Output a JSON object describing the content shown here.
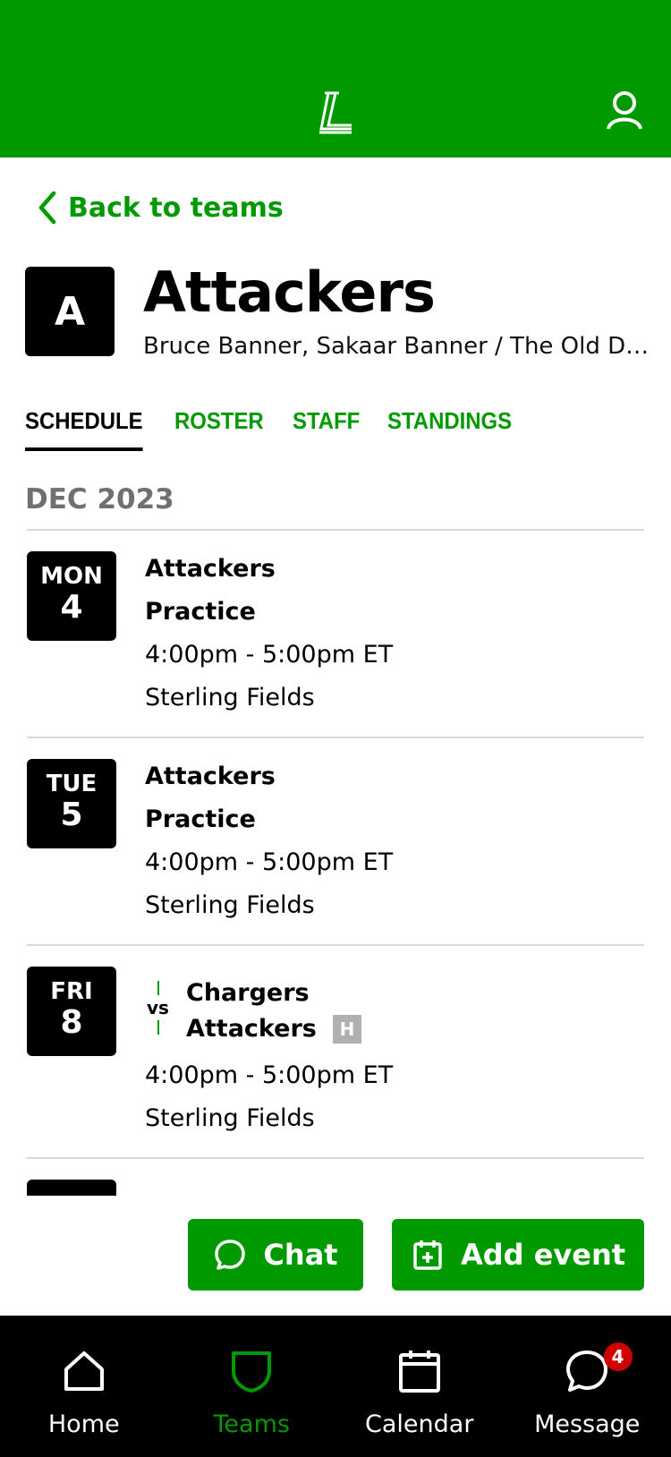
{
  "header": {
    "logo_icon": "league-logo-icon",
    "profile_icon": "profile-icon",
    "color": "#009a00"
  },
  "back": {
    "label": "Back to teams"
  },
  "team": {
    "initial": "A",
    "name": "Attackers",
    "subtitle": "Bruce Banner, Sakaar Banner / The Old Do..."
  },
  "tabs": [
    {
      "label": "SCHEDULE",
      "active": true
    },
    {
      "label": "ROSTER",
      "active": false
    },
    {
      "label": "STAFF",
      "active": false
    },
    {
      "label": "STANDINGS",
      "active": false
    }
  ],
  "schedule": {
    "month": "DEC 2023",
    "events": [
      {
        "dow": "MON",
        "day": "4",
        "team": "Attackers",
        "type": "Practice",
        "time": "4:00pm - 5:00pm ET",
        "location": "Sterling Fields"
      },
      {
        "dow": "TUE",
        "day": "5",
        "team": "Attackers",
        "type": "Practice",
        "time": "4:00pm - 5:00pm ET",
        "location": "Sterling Fields"
      },
      {
        "dow": "FRI",
        "day": "8",
        "vs": "vs",
        "away_team": "Chargers",
        "home_team": "Attackers",
        "home_badge": "H",
        "time": "4:00pm - 5:00pm ET",
        "location": "Sterling Fields"
      }
    ]
  },
  "actions": {
    "chat_label": "Chat",
    "add_event_label": "Add event"
  },
  "nav": {
    "items": [
      {
        "label": "Home",
        "icon": "home-icon"
      },
      {
        "label": "Teams",
        "icon": "shield-icon",
        "active": true
      },
      {
        "label": "Calendar",
        "icon": "calendar-icon"
      },
      {
        "label": "Message",
        "icon": "message-icon",
        "badge": "4"
      }
    ]
  }
}
